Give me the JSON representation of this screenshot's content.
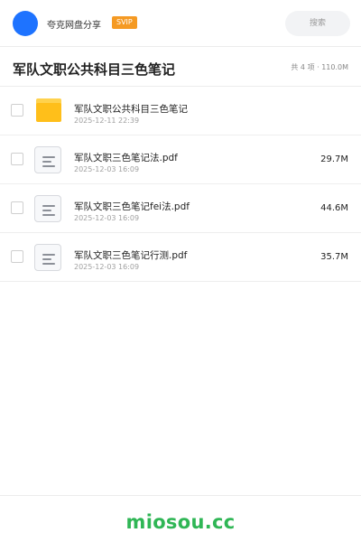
{
  "header": {
    "app_name": "夸克网盘分享",
    "badge": "SVIP",
    "search_placeholder": "搜索"
  },
  "folder": {
    "title": "军队文职公共科目三色笔记",
    "summary": "共 4 项 · 110.0M"
  },
  "files": [
    {
      "type": "folder",
      "icon": "folder-icon",
      "name": "军队文职公共科目三色笔记",
      "date": "2025-12-11 22:39",
      "size": ""
    },
    {
      "type": "pdf",
      "icon": "document-icon",
      "name": "军队文职三色笔记法.pdf",
      "date": "2025-12-03 16:09",
      "size": "29.7M"
    },
    {
      "type": "pdf",
      "icon": "document-icon",
      "name": "军队文职三色笔记fei法.pdf",
      "date": "2025-12-03 16:09",
      "size": "44.6M"
    },
    {
      "type": "pdf",
      "icon": "document-icon",
      "name": "军队文职三色笔记行测.pdf",
      "date": "2025-12-03 16:09",
      "size": "35.7M"
    }
  ],
  "watermark": "miosou.cc",
  "colors": {
    "avatar": "#1e73ff",
    "badge": "#f59a23",
    "folder": "#ffbf1a",
    "watermark": "#2fb655"
  }
}
